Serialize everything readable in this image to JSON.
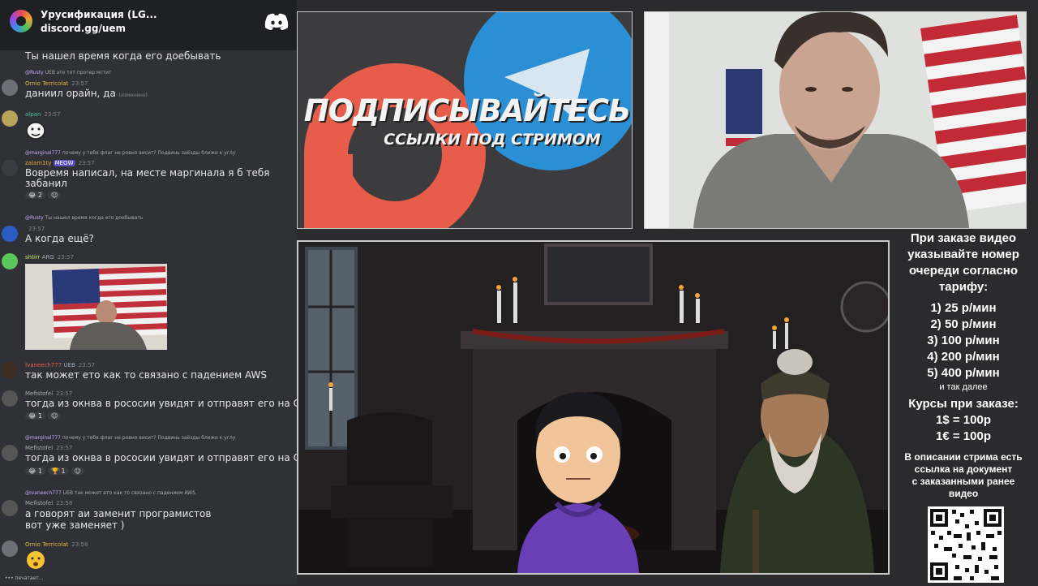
{
  "server": {
    "name": "Урусификация (LG...",
    "invite": "discord.gg/uem"
  },
  "messages": [
    {
      "text": "Ты нашел время когда его доебывать"
    },
    {
      "reply_user": "@Rusty",
      "reply_tag": "UEB",
      "reply_text": "это тот прогер мстит",
      "user": "Ornio Terricolat",
      "time": "23:57",
      "text": "даниил орайн, да",
      "edited": "(изменено)"
    },
    {
      "user": "alpan",
      "time": "23:57"
    },
    {
      "reply_user": "@marginal777",
      "reply_text": "почему у тебя флаг не ровно висит? Подвинь заёзды ближе к углу",
      "user": "zalam1ty",
      "badge": "MEOW",
      "time": "23:57",
      "text": "Вовремя написал, на месте маргинала я б тебя",
      "text2": "забанил",
      "reaction": "2"
    },
    {
      "reply_user": "@Rusty",
      "reply_text": "Ты нашел время когда его доебывать",
      "time": "23:57",
      "text": "А когда ещё?"
    },
    {
      "user": "shtirr",
      "badge": "ARG",
      "time": "23:57"
    },
    {
      "user": "Ivaneech777",
      "badge": "UEB",
      "time": "23:57",
      "text": "так может ето как то связано с падением AWS"
    },
    {
      "user": "Mefistofel",
      "time": "23:57",
      "text": "тогда из окнва в росоcии увидят и отправят его на СВО",
      "reaction": "1"
    },
    {
      "reply_user": "@marginal777",
      "reply_text": "почему у тебя флаг не ровно висит? Подвинь заёзды ближе к углу",
      "user": "Mefistofel",
      "time": "23:57",
      "text": "тогда из окнва в росоcии увидят и отправят его на СВО",
      "reaction": "1",
      "reaction2": "1"
    },
    {
      "reply_user": "@Ivaneech777",
      "reply_tag": "UEB",
      "reply_text": "так может ето как то связано с падением AWS",
      "user": "Mefistofel",
      "time": "23:58",
      "text": "а говорят аи заменит програмистов",
      "text2": "вот уже заменяет )"
    },
    {
      "user": "Ornio Terricolat",
      "time": "23:58"
    }
  ],
  "typing": "печатает...",
  "promo": {
    "title": "ПОДПИСЫВАЙТЕСЬ",
    "subtitle": "ССЫЛКИ ПОД СТРИМОМ"
  },
  "info": {
    "intro": [
      "При заказе видео",
      "указывайте номер",
      "очереди согласно",
      "тарифу:"
    ],
    "tariffs": [
      "1) 25 р/мин",
      "2) 50 р/мин",
      "3) 100 р/мин",
      "4) 200 р/мин",
      "5) 400 р/мин"
    ],
    "etc": "и так далее",
    "rates_title": "Курсы при заказе:",
    "rates": [
      "1$ = 100р",
      "1€ = 100р"
    ],
    "desc": [
      "В описании стрима есть",
      "ссылка на документ",
      "с заказанными ранее",
      "видео"
    ]
  },
  "colors": {
    "accent_red": "#e85d4a",
    "telegram_blue": "#2b8fd6",
    "chat_bg": "#2f3136"
  }
}
